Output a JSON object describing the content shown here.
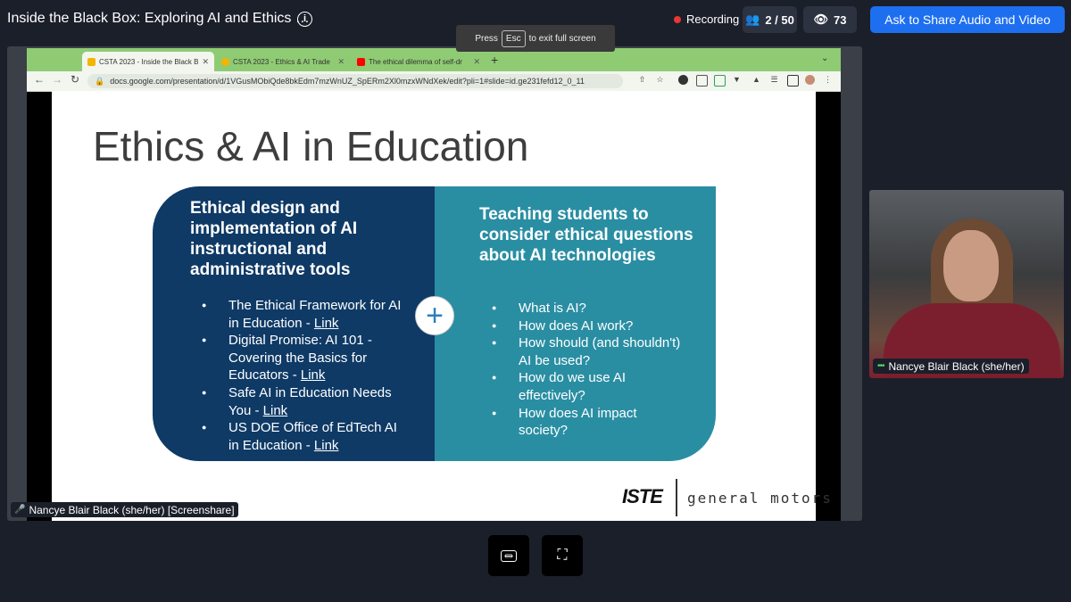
{
  "header": {
    "session_title": "Inside the Black Box: Exploring AI and Ethics …",
    "recording_label": "Recording",
    "participants": "2 / 50",
    "viewers": "73",
    "ask_button": "Ask to Share Audio and Video"
  },
  "toast": {
    "press": "Press",
    "key": "Esc",
    "rest": "to exit full screen"
  },
  "browser": {
    "tabs": [
      {
        "label": "CSTA 2023 - Inside the Black B",
        "favicon_color": "#f4b400",
        "active": true
      },
      {
        "label": "CSTA 2023 - Ethics & AI Trade",
        "favicon_color": "#f4b400",
        "active": false
      },
      {
        "label": "The ethical dilemma of self-dr",
        "favicon_color": "#ff0000",
        "active": false
      }
    ],
    "url": "docs.google.com/presentation/d/1VGusMObiQde8bkEdm7mzWnUZ_SpERm2Xl0mzxWNdXek/edit?pli=1#slide=id.ge231fefd12_0_11"
  },
  "slide": {
    "title": "Ethics & AI in Education",
    "left_heading": "Ethical design and implementation of AI instructional and administrative tools",
    "left_items": [
      {
        "text": "The Ethical Framework for AI in Education - ",
        "link": "Link"
      },
      {
        "text": "Digital Promise: AI 101 - Covering the Basics for Educators - ",
        "link": "Link"
      },
      {
        "text": "Safe AI in Education Needs You - ",
        "link": "Link"
      },
      {
        "text": "US DOE Office of EdTech AI in Education - ",
        "link": "Link"
      }
    ],
    "right_heading": "Teaching students to consider ethical questions about AI technologies",
    "right_items": [
      "What is AI?",
      "How does AI work?",
      "How should (and shouldn't) AI be used?",
      "How do we use AI effectively?",
      "How does AI impact society?"
    ],
    "plus": "+",
    "logo_left": "ISTE",
    "logo_right": "general motors"
  },
  "screenshare_tag": "Nancye Blair Black (she/her) [Screenshare]",
  "camera_tag": "Nancye Blair Black (she/her)",
  "colors": {
    "accent": "#1e6ff0",
    "left_panel": "#0f3a66",
    "right_panel": "#2a8ea3",
    "tab_bar": "#8fcb73",
    "recording": "#e53935"
  }
}
